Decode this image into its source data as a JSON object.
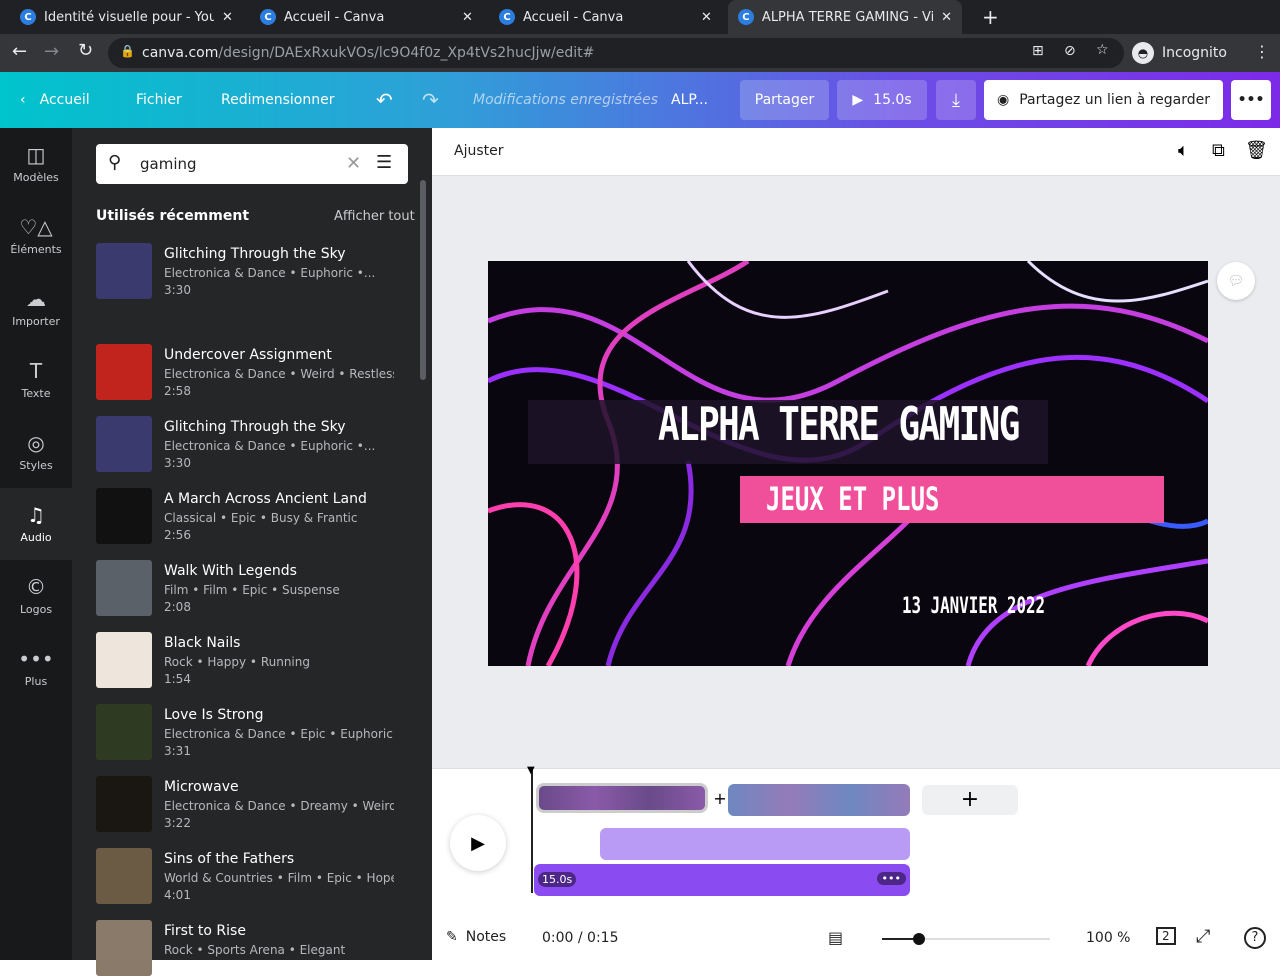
{
  "browser": {
    "tabs": [
      {
        "title": "Identité visuelle pour - You"
      },
      {
        "title": "Accueil - Canva"
      },
      {
        "title": "Accueil - Canva"
      },
      {
        "title": "ALPHA TERRE GAMING - Vi"
      }
    ],
    "url_host": "canva.com",
    "url_path": "/design/DAExRxukVOs/lc9O4f0z_Xp4tVs2hucJjw/edit#",
    "profile": "Incognito"
  },
  "topbar": {
    "home": "Accueil",
    "file": "Fichier",
    "resize": "Redimensionner",
    "saved": "Modifications enregistrées",
    "design_title": "ALP...",
    "share": "Partager",
    "duration": "15.0s",
    "share_link": "Partagez un lien à regarder"
  },
  "rail": [
    {
      "label": "Modèles"
    },
    {
      "label": "Éléments"
    },
    {
      "label": "Importer"
    },
    {
      "label": "Texte"
    },
    {
      "label": "Styles"
    },
    {
      "label": "Audio"
    },
    {
      "label": "Logos"
    },
    {
      "label": "Plus"
    }
  ],
  "panel": {
    "search_value": "gaming",
    "section_title": "Utilisés récemment",
    "see_all": "Afficher tout",
    "items": [
      {
        "title": "Glitching Through the Sky",
        "meta": "Electronica & Dance • Euphoric •...",
        "duration": "3:30",
        "color": "#3b3a6e"
      },
      {
        "title": "Undercover Assignment",
        "meta": "Electronica & Dance • Weird • Restless",
        "duration": "2:58",
        "color": "#c0241c"
      },
      {
        "title": "Glitching Through the Sky",
        "meta": "Electronica & Dance • Euphoric •...",
        "duration": "3:30",
        "color": "#3b3a6e"
      },
      {
        "title": "A March Across Ancient Land",
        "meta": "Classical • Epic • Busy & Frantic",
        "duration": "2:56",
        "color": "#111"
      },
      {
        "title": "Walk With Legends",
        "meta": "Film • Film • Epic • Suspense",
        "duration": "2:08",
        "color": "#5b6168"
      },
      {
        "title": "Black Nails",
        "meta": "Rock • Happy • Running",
        "duration": "1:54",
        "color": "#eee6dc"
      },
      {
        "title": "Love Is Strong",
        "meta": "Electronica & Dance • Epic • Euphoric",
        "duration": "3:31",
        "color": "#2e3a22"
      },
      {
        "title": "Microwave",
        "meta": "Electronica & Dance • Dreamy • Weird",
        "duration": "3:22",
        "color": "#1a1612"
      },
      {
        "title": "Sins of the Fathers",
        "meta": "World & Countries • Film • Epic • Hopeful",
        "duration": "4:01",
        "color": "#6b5a44"
      },
      {
        "title": "First to Rise",
        "meta": "Rock • Sports Arena • Elegant",
        "duration": "",
        "color": "#8a7a6a"
      }
    ]
  },
  "editor": {
    "adjust": "Ajuster"
  },
  "design": {
    "title": "ALPHA TERRE GAMING",
    "subtitle": "JEUX ET PLUS",
    "date": "13 JANVIER 2022"
  },
  "timeline": {
    "audio_duration": "15.0s"
  },
  "footer": {
    "notes": "Notes",
    "time": "0:00 / 0:15",
    "zoom": "100 %",
    "zoom_fraction": 0.1,
    "pages": "2"
  }
}
